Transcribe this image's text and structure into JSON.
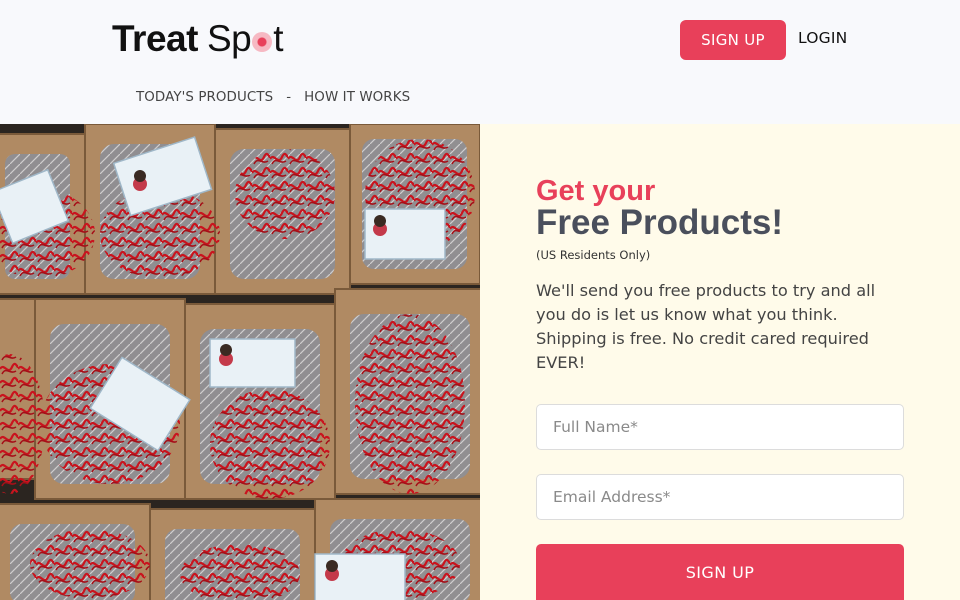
{
  "brand": {
    "logo_word1": "Treat",
    "logo_word2_prefix": "Sp",
    "logo_word2_suffix": "t",
    "accent_color": "#e8405a",
    "heading_color": "#4a4f5c",
    "panel_bg": "#fffbea"
  },
  "header": {
    "signup_label": "SIGN UP",
    "login_label": "LOGIN"
  },
  "nav": {
    "items": [
      {
        "label": "TODAY'S PRODUCTS"
      },
      {
        "label": "HOW IT WORKS"
      }
    ],
    "separator": "-"
  },
  "hero": {
    "photo_alt": "boxes-of-products-icon"
  },
  "offer": {
    "heading_line1": "Get your",
    "heading_line2": "Free Products!",
    "note": "(US Residents Only)",
    "description": "We'll send you free products to try and all you do is let us know what you think. Shipping is free. No credit cared required EVER!"
  },
  "form": {
    "full_name_placeholder": "Full Name*",
    "email_placeholder": "Email Address*",
    "submit_label": "SIGN UP"
  }
}
